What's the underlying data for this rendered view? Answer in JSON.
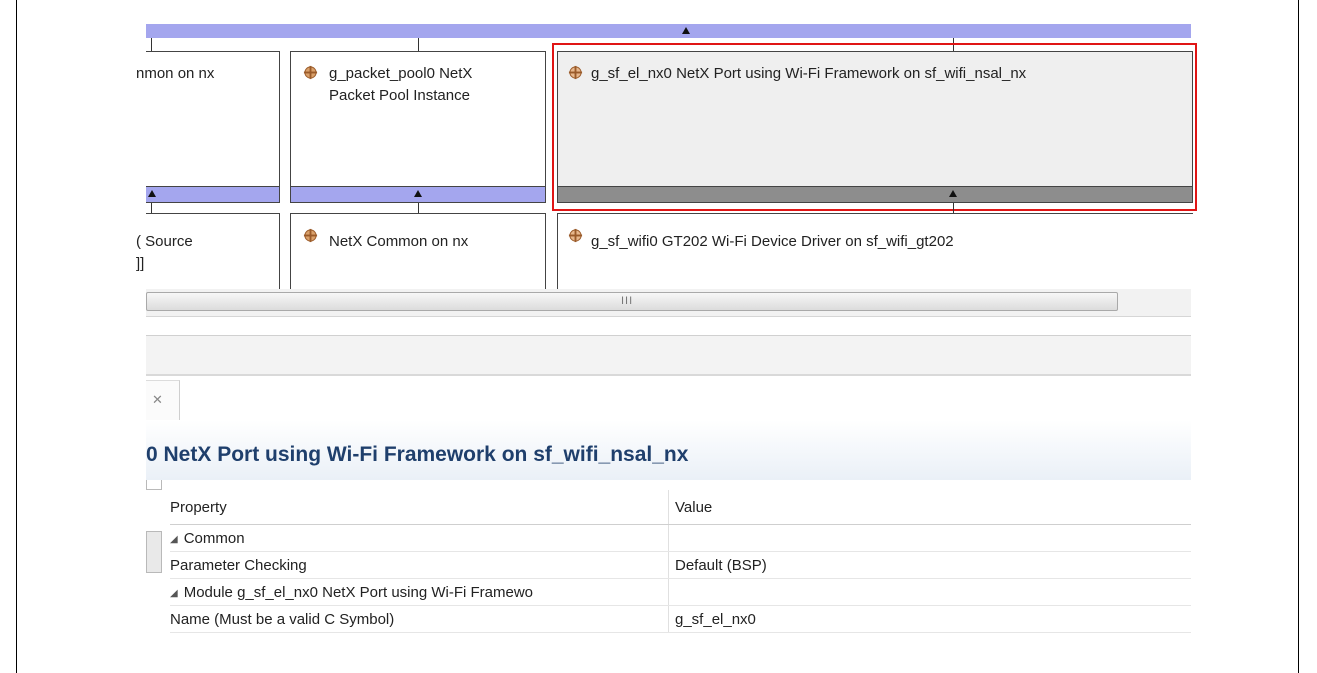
{
  "graph": {
    "row1": {
      "box_a_title": "nmon on nx",
      "box_b_title_line1": "g_packet_pool0 NetX",
      "box_b_title_line2": "Packet Pool Instance",
      "box_c_title": "g_sf_el_nx0 NetX Port using Wi-Fi Framework on sf_wifi_nsal_nx"
    },
    "row2": {
      "box_a_title_line1": "( Source",
      "box_a_title_line2": "]]",
      "box_b_title": "NetX Common on nx",
      "box_c_title": "g_sf_wifi0 GT202 Wi-Fi Device Driver on sf_wifi_gt202"
    },
    "icons": {
      "module_icon": "gear-module-icon",
      "stack_icon": "crosshair-module-icon"
    },
    "colors": {
      "footer_bar": "#a4a6ee",
      "selected_footer": "#8d8d8d",
      "selection_outline": "#e01515"
    },
    "scrollbar_grip": "III"
  },
  "properties": {
    "tab_close_glyph": "✕",
    "title": "0 NetX Port using Wi-Fi Framework on sf_wifi_nsal_nx",
    "columns": {
      "property": "Property",
      "value": "Value"
    },
    "rows": [
      {
        "label": "Common",
        "value": ""
      },
      {
        "label": "Parameter Checking",
        "value": "Default (BSP)"
      },
      {
        "label": "Module g_sf_el_nx0 NetX Port using Wi-Fi Framewo",
        "value": ""
      },
      {
        "label": "Name (Must be a valid C Symbol)",
        "value": "g_sf_el_nx0"
      }
    ]
  }
}
